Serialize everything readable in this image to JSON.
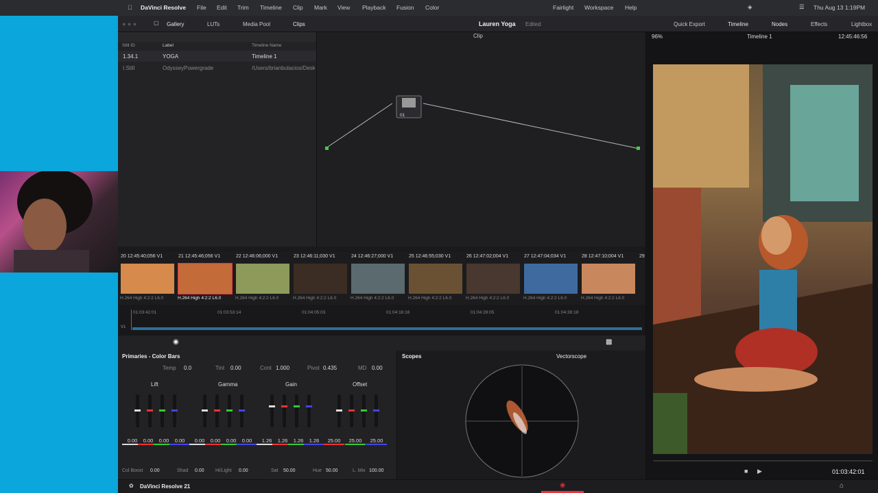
{
  "menubar": {
    "app": "DaVinci Resolve",
    "items": [
      "File",
      "Edit",
      "Trim",
      "Timeline",
      "Clip",
      "Mark",
      "View",
      "Playback",
      "Fusion",
      "Color",
      "Fairlight",
      "Workspace",
      "Help"
    ],
    "clock": "Thu Aug 13  1:19PM"
  },
  "toolbar": {
    "gallery": "Gallery",
    "luts": "LUTs",
    "media_pool": "Media Pool",
    "clips": "Clips",
    "project": "Lauren Yoga",
    "status": "Edited",
    "quick_export": "Quick Export",
    "timeline": "Timeline",
    "nodes": "Nodes",
    "effects": "Effects",
    "lightbox": "Lightbox"
  },
  "gallery": {
    "col1": "Still ID",
    "col2": "Label",
    "col3": "Timeline Name",
    "rows": [
      {
        "id": "1.34.1",
        "label": "YOGA",
        "tl": "Timeline 1"
      },
      {
        "id": "I.Still",
        "label": "OdysseyPowergrade",
        "tl": "/Users/brianbulacios/Desk"
      }
    ]
  },
  "nodes": {
    "mode": "Clip",
    "node_label": "01"
  },
  "viewer": {
    "zoom": "96%",
    "timeline": "Timeline 1",
    "tc": "12:45:46:56",
    "play_tc": "01:03:42:01"
  },
  "strip": {
    "clips": [
      {
        "n": "20",
        "tc": "12:45:40;056",
        "track": "V1"
      },
      {
        "n": "21",
        "tc": "12:45:46;056",
        "track": "V1"
      },
      {
        "n": "22",
        "tc": "12:46:06;000",
        "track": "V1"
      },
      {
        "n": "23",
        "tc": "12:46:11;030",
        "track": "V1"
      },
      {
        "n": "24",
        "tc": "12:46:27;000",
        "track": "V1"
      },
      {
        "n": "25",
        "tc": "12:46:55;030",
        "track": "V1"
      },
      {
        "n": "26",
        "tc": "12:47:02;004",
        "track": "V1"
      },
      {
        "n": "27",
        "tc": "12:47:04;034",
        "track": "V1"
      },
      {
        "n": "28",
        "tc": "12:47:10;004",
        "track": "V1"
      },
      {
        "n": "29",
        "tc": "",
        "track": ""
      }
    ],
    "codec": "H.264 High 4:2:2 L6.0"
  },
  "timeline": {
    "ruler": [
      "01:03:42:01",
      "01:03:53:14",
      "01:04:05:03",
      "01:04:16:16",
      "01:04:28:05",
      "01:04:39:18"
    ],
    "track": "V1"
  },
  "primaries": {
    "title": "Primaries - Color Bars",
    "temp_l": "Temp",
    "temp": "0.0",
    "tint_l": "Tint",
    "tint": "0.00",
    "cont_l": "Cont",
    "cont": "1.000",
    "pivot_l": "Pivot",
    "pivot": "0.435",
    "md_l": "MD",
    "md": "0.00",
    "wheels": [
      {
        "name": "Lift",
        "vals": [
          "0.00",
          "0.00",
          "0.00",
          "0.00"
        ]
      },
      {
        "name": "Gamma",
        "vals": [
          "0.00",
          "0.00",
          "0.00",
          "0.00"
        ]
      },
      {
        "name": "Gain",
        "vals": [
          "1.26",
          "1.26",
          "1.26",
          "1.26"
        ]
      },
      {
        "name": "Offset",
        "vals": [
          "25.00",
          "25.00",
          "25.00"
        ]
      }
    ],
    "colboost_l": "Col Boost",
    "colboost": "0.00",
    "shad_l": "Shad",
    "shad": "0.00",
    "hilight_l": "Hi/Light",
    "hilight": "0.00",
    "sat_l": "Sat",
    "sat": "50.00",
    "hue_l": "Hue",
    "hue": "50.00",
    "lmix_l": "L. Mix",
    "lmix": "100.00"
  },
  "scopes": {
    "title": "Scopes",
    "type": "Vectorscope"
  },
  "pagebar": {
    "app": "DaVinci Resolve 21"
  },
  "colors": {
    "accent": "#e8343c",
    "bg": "#222225"
  }
}
